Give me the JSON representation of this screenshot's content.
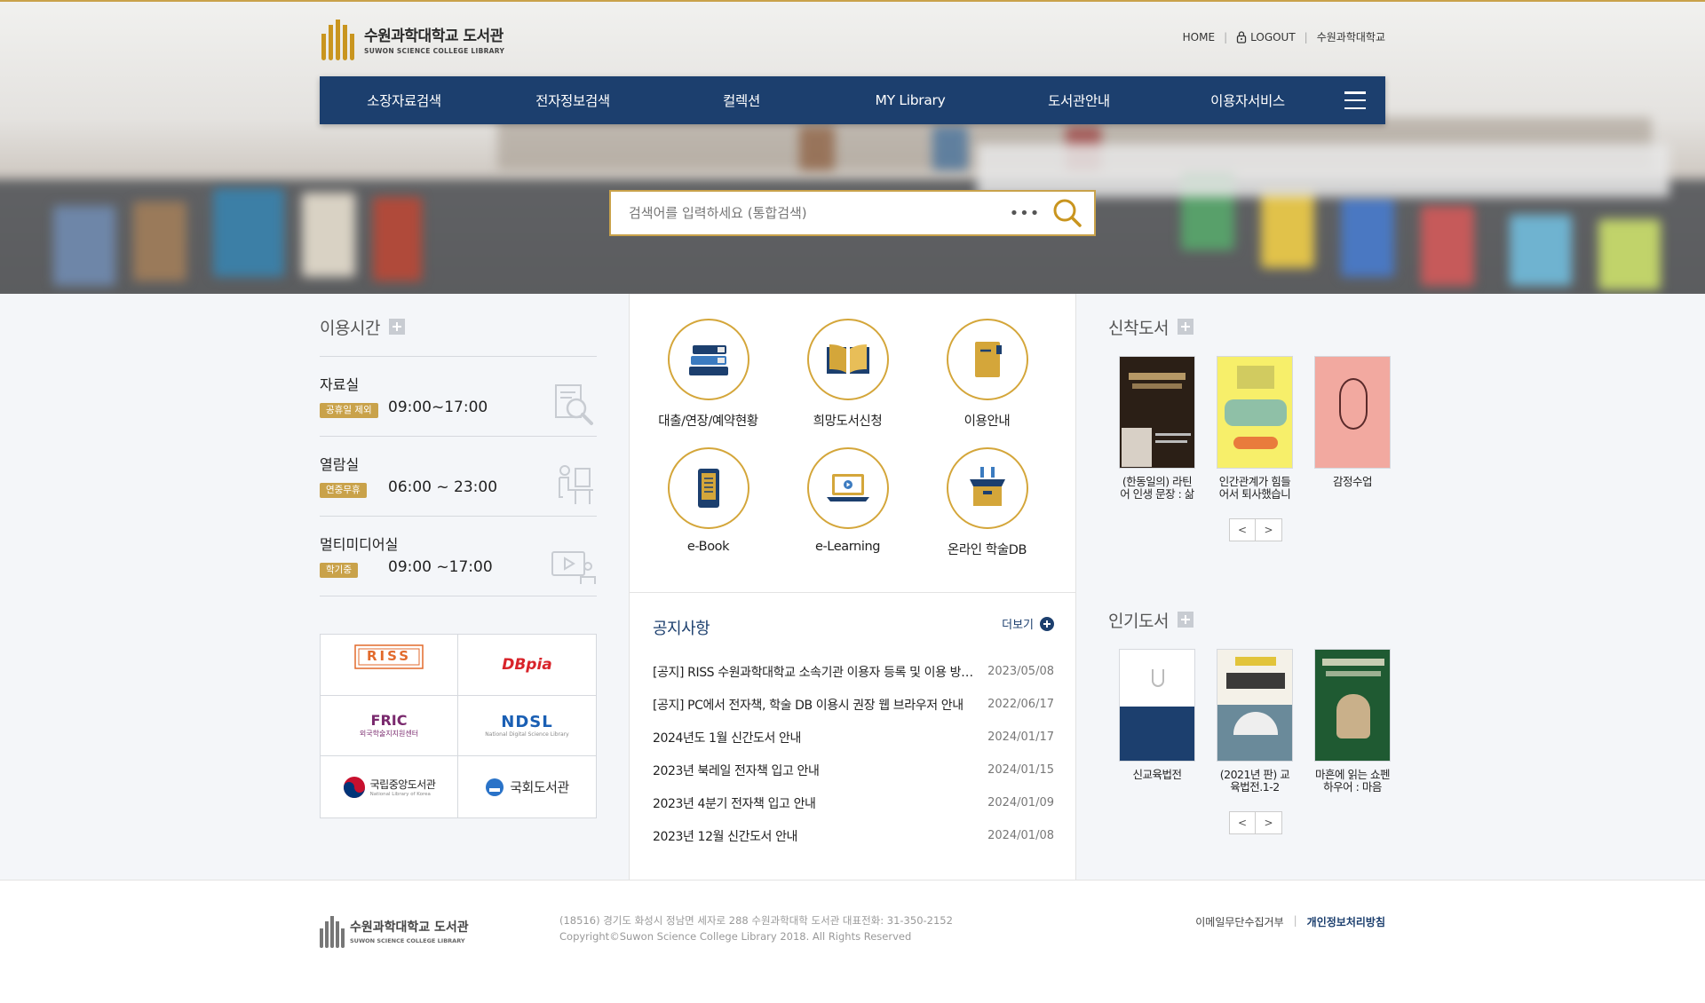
{
  "header": {
    "logo_kr": "수원과학대학교 도서관",
    "logo_en": "SUWON SCIENCE COLLEGE  LIBRARY",
    "util": [
      "HOME",
      "LOGOUT",
      "수원과학대학교"
    ]
  },
  "gnb": [
    "소장자료검색",
    "전자정보검색",
    "컬렉션",
    "MY Library",
    "도서관안내",
    "이용자서비스"
  ],
  "search": {
    "placeholder": "검색어를 입력하세요 (통합검색)",
    "more": "•••"
  },
  "hours": {
    "title": "이용시간",
    "rows": [
      {
        "name": "자료실",
        "badge": "공휴일 제외",
        "time": "09:00~17:00"
      },
      {
        "name": "열람실",
        "badge": "연중무휴",
        "time": "06:00 ~ 23:00"
      },
      {
        "name": "멀티미디어실",
        "badge": "학기중",
        "time": "09:00 ~17:00"
      }
    ]
  },
  "links": {
    "riss": "RISS",
    "dbpia": "DBpia",
    "fric": "FRIC",
    "fric_sub": "외국학술지지원센터",
    "ndsl": "NDSL",
    "ndsl_sub": "National Digital Science Library",
    "nlk": "국립중앙도서관",
    "nlk_sub": "National Library of Korea",
    "nanet": "국회도서관"
  },
  "services": [
    {
      "label": "대출/연장/예약현황",
      "icon": "books-stack-icon"
    },
    {
      "label": "희망도서신청",
      "icon": "open-book-icon"
    },
    {
      "label": "이용안내",
      "icon": "notebook-icon"
    },
    {
      "label": "e-Book",
      "icon": "ebook-reader-icon"
    },
    {
      "label": "e-Learning",
      "icon": "laptop-play-icon"
    },
    {
      "label": "온라인 학술DB",
      "icon": "database-box-icon"
    }
  ],
  "notice": {
    "title": "공지사항",
    "more": "더보기",
    "items": [
      {
        "title": "[공지] RISS 수원과학대학교 소속기관 이용자 등록 및 이용 방법 안내",
        "date": "2023/05/08"
      },
      {
        "title": "[공지] PC에서 전자책, 학술 DB 이용시 권장 웹 브라우저 안내",
        "date": "2022/06/17"
      },
      {
        "title": "2024년도 1월 신간도서 안내",
        "date": "2024/01/17"
      },
      {
        "title": "2023년 북레일 전자책 입고 안내",
        "date": "2024/01/15"
      },
      {
        "title": "2023년 4분기 전자책 입고 안내",
        "date": "2024/01/09"
      },
      {
        "title": "2023년 12월 신간도서 안내",
        "date": "2024/01/08"
      }
    ]
  },
  "new_books": {
    "title": "신착도서",
    "books": [
      {
        "title": "(한동일의) 라틴어 인생 문장 : 삶"
      },
      {
        "title": "인간관계가 힘들어서 퇴사했습니"
      },
      {
        "title": "감정수업"
      }
    ]
  },
  "popular_books": {
    "title": "인기도서",
    "books": [
      {
        "title": "신교육법전"
      },
      {
        "title": "(2021년 판) 교육법전.1-2"
      },
      {
        "title": "마흔에 읽는 쇼펜하우어 : 마음"
      }
    ]
  },
  "pager": {
    "prev": "<",
    "next": ">"
  },
  "footer": {
    "logo_kr": "수원과학대학교 도서관",
    "logo_en": "SUWON SCIENCE COLLEGE  LIBRARY",
    "address": "(18516) 경기도 화성시 정남면 세자로 288 수원과학대학 도서관 대표전화: 31-350-2152",
    "copyright": "Copyright©Suwon Science College Library 2018. All Rights Reserved",
    "links": [
      "이메일무단수집거부",
      "개인정보처리방침"
    ]
  },
  "colors": {
    "navy": "#1c3f6e",
    "gold": "#c9a24a"
  }
}
